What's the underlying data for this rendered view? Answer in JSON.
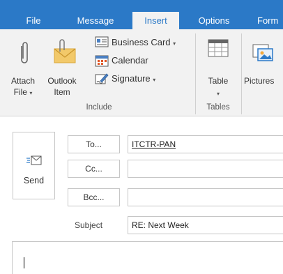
{
  "tabs": [
    {
      "label": "File",
      "active": false
    },
    {
      "label": "Message",
      "active": false
    },
    {
      "label": "Insert",
      "active": true
    },
    {
      "label": "Options",
      "active": false
    },
    {
      "label": "Form",
      "active": false
    }
  ],
  "ribbon": {
    "attach_file": {
      "line1": "Attach",
      "line2": "File",
      "icon": "paperclip-icon"
    },
    "outlook_item": {
      "line1": "Outlook",
      "line2": "Item",
      "icon": "envelope-paperclip-icon"
    },
    "business_card": {
      "label": "Business Card",
      "icon": "business-card-icon"
    },
    "calendar": {
      "label": "Calendar",
      "icon": "calendar-icon"
    },
    "signature": {
      "label": "Signature",
      "icon": "signature-icon"
    },
    "table": {
      "label": "Table",
      "icon": "table-icon"
    },
    "pictures": {
      "label": "Pictures",
      "icon": "pictures-icon"
    },
    "groups": {
      "include": "Include",
      "tables": "Tables"
    }
  },
  "compose": {
    "send_label": "Send",
    "to_label": "To...",
    "cc_label": "Cc...",
    "bcc_label": "Bcc...",
    "to_value": "ITCTR-PAN",
    "cc_value": "",
    "bcc_value": "",
    "subject_label": "Subject",
    "subject_value": "RE: Next Week"
  },
  "colors": {
    "accent": "#2b79c7",
    "ribbon_bg": "#f2f2f2"
  }
}
